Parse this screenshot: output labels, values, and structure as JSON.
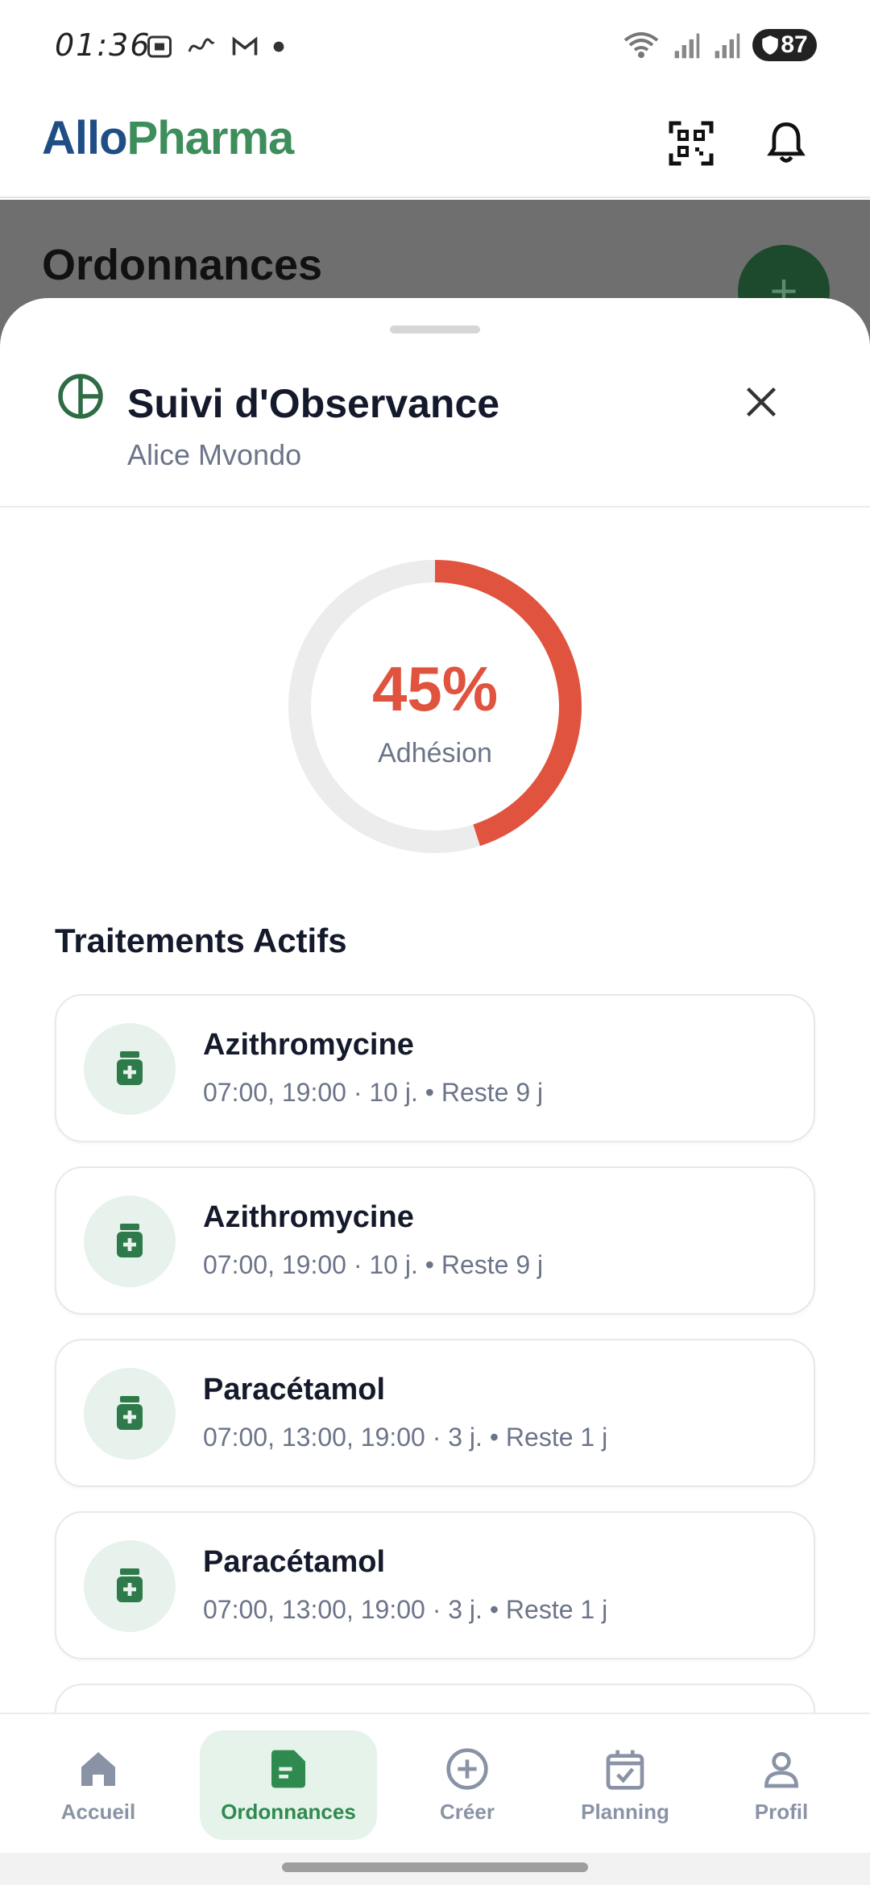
{
  "status_bar": {
    "time": "01:36",
    "battery": "87"
  },
  "header": {
    "logo_part1": "Allo",
    "logo_part2": "Pharma"
  },
  "background_page": {
    "title": "Ordonnances",
    "fab_symbol": "+"
  },
  "sheet": {
    "title": "Suivi d'Observance",
    "patient": "Alice Mvondo",
    "adherence": {
      "value_text": "45%",
      "percent": 45,
      "label": "Adhésion"
    },
    "section_title": "Traitements Actifs",
    "treatments": [
      {
        "name": "Azithromycine",
        "detail": "07:00, 19:00 · 10 j. • Reste 9 j"
      },
      {
        "name": "Azithromycine",
        "detail": "07:00, 19:00 · 10 j. • Reste 9 j"
      },
      {
        "name": "Paracétamol",
        "detail": "07:00, 13:00, 19:00 · 3 j. • Reste 1 j"
      },
      {
        "name": "Paracétamol",
        "detail": "07:00, 13:00, 19:00 · 3 j. • Reste 1 j"
      }
    ]
  },
  "nav": {
    "items": [
      {
        "label": "Accueil",
        "icon": "home-icon"
      },
      {
        "label": "Ordonnances",
        "icon": "document-icon",
        "active": true
      },
      {
        "label": "Créer",
        "icon": "plus-circle-icon"
      },
      {
        "label": "Planning",
        "icon": "calendar-check-icon"
      },
      {
        "label": "Profil",
        "icon": "user-icon"
      }
    ]
  },
  "colors": {
    "accent_green": "#2f8a4f",
    "adherence_red": "#e0533e",
    "brand_blue": "#1f4e86"
  }
}
